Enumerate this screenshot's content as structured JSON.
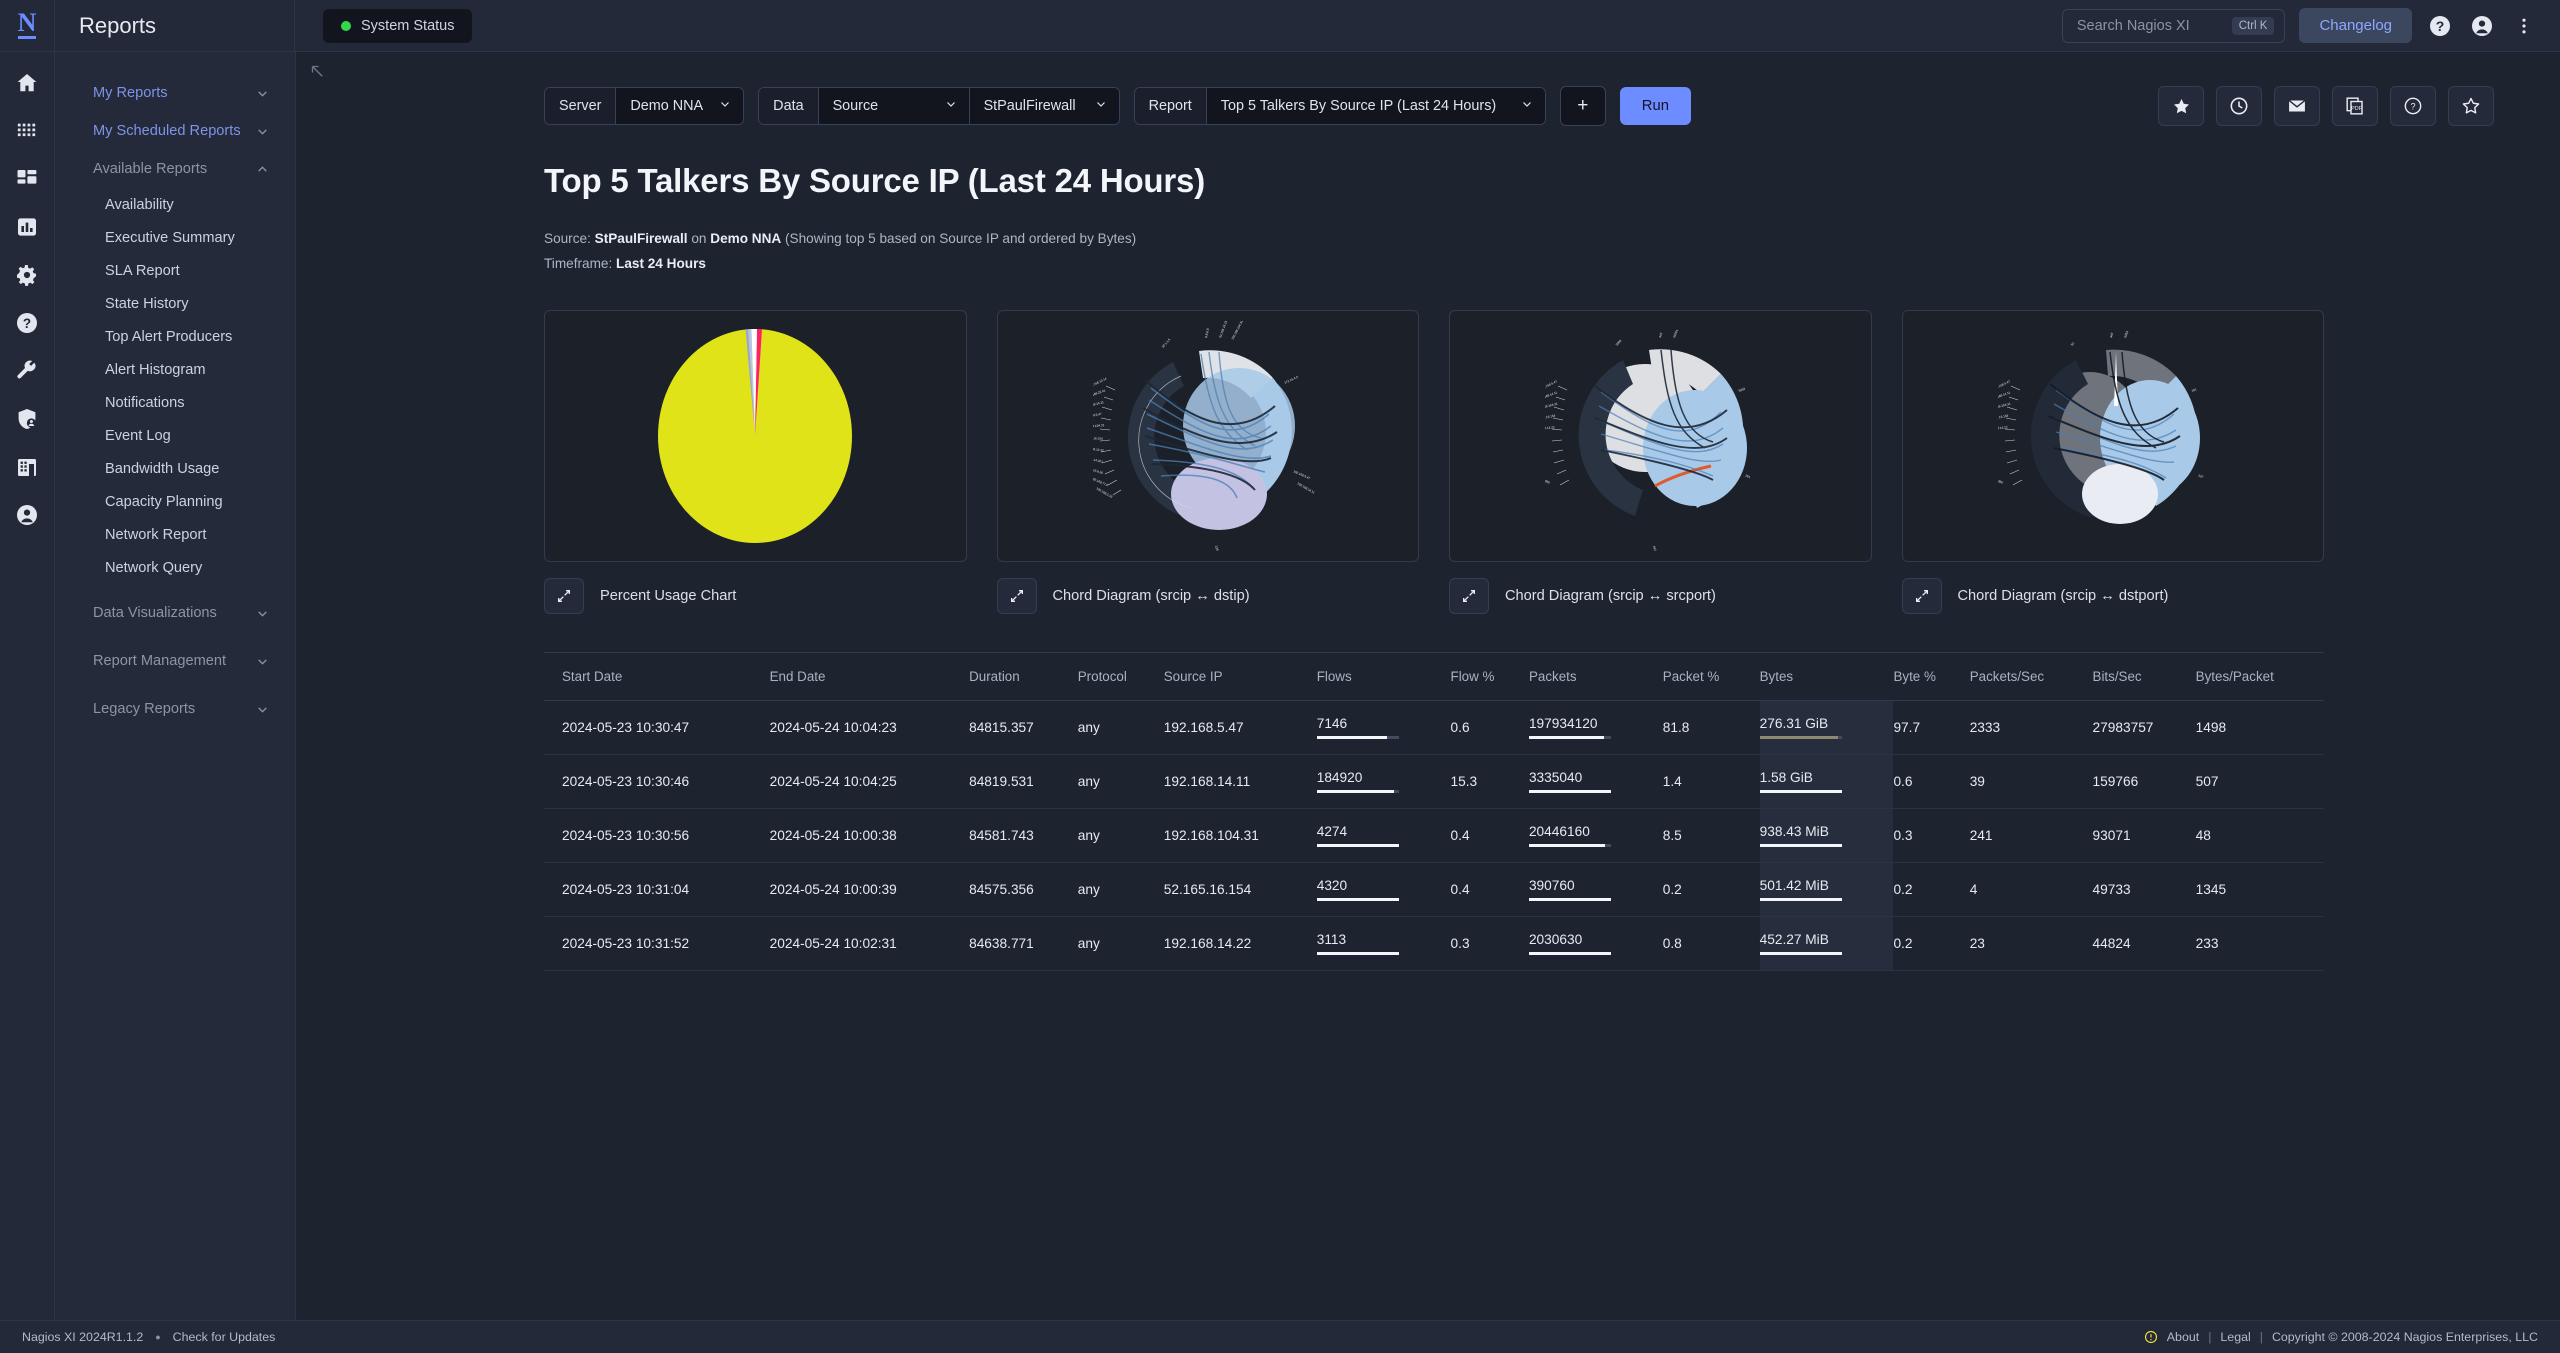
{
  "topbar": {
    "logo": "N",
    "app_title": "Reports",
    "system_status": "System Status",
    "search_placeholder": "Search Nagios XI",
    "search_shortcut": "Ctrl K",
    "changelog": "Changelog",
    "help_icon": "help-circle-icon",
    "account_icon": "account-circle-icon",
    "more_icon": "more-vertical-icon"
  },
  "rail": [
    {
      "name": "home-icon"
    },
    {
      "name": "apps-grid-icon"
    },
    {
      "name": "dashboard-icon"
    },
    {
      "name": "bar-chart-icon"
    },
    {
      "name": "gear-icon"
    },
    {
      "name": "help-circle-icon"
    },
    {
      "name": "wrench-icon"
    },
    {
      "name": "shield-user-icon"
    },
    {
      "name": "building-icon"
    },
    {
      "name": "user-circle-icon"
    }
  ],
  "sidebar": {
    "groups": [
      {
        "label": "My Reports",
        "expanded": false,
        "muted": false
      },
      {
        "label": "My Scheduled Reports",
        "expanded": false,
        "muted": false
      }
    ],
    "available_reports_label": "Available Reports",
    "items": [
      {
        "label": "Availability"
      },
      {
        "label": "Executive Summary"
      },
      {
        "label": "SLA Report"
      },
      {
        "label": "State History"
      },
      {
        "label": "Top Alert Producers"
      },
      {
        "label": "Alert Histogram"
      },
      {
        "label": "Notifications"
      },
      {
        "label": "Event Log"
      },
      {
        "label": "Bandwidth Usage"
      },
      {
        "label": "Capacity Planning"
      },
      {
        "label": "Network Report"
      },
      {
        "label": "Network Query"
      }
    ],
    "bottom_groups": [
      {
        "label": "Data Visualizations"
      },
      {
        "label": "Report Management"
      },
      {
        "label": "Legacy Reports"
      }
    ]
  },
  "toolbar": {
    "server_label": "Server",
    "server_value": "Demo NNA",
    "data_label": "Data",
    "data_value": "Source",
    "source_value": "StPaulFirewall",
    "report_label": "Report",
    "report_value": "Top 5 Talkers By Source IP (Last 24 Hours)",
    "add_label": "+",
    "run_label": "Run",
    "icons": [
      {
        "name": "star-filled-icon"
      },
      {
        "name": "clock-icon"
      },
      {
        "name": "envelope-icon"
      },
      {
        "name": "pdf-copy-icon"
      },
      {
        "name": "help-circle-icon"
      },
      {
        "name": "star-outline-icon"
      }
    ]
  },
  "report": {
    "title": "Top 5 Talkers By Source IP (Last 24 Hours)",
    "source_prefix": "Source:",
    "source_name": "StPaulFirewall",
    "source_on": "on",
    "source_server": "Demo NNA",
    "source_suffix": "(Showing top 5 based on Source IP and ordered by Bytes)",
    "timeframe_label": "Timeframe:",
    "timeframe_value": "Last 24 Hours"
  },
  "cards": [
    {
      "caption": "Percent Usage Chart",
      "type": "pie"
    },
    {
      "caption": "Chord Diagram (srcip ↔ dstip)",
      "type": "chord"
    },
    {
      "caption": "Chord Diagram (srcip ↔ srcport)",
      "type": "chord"
    },
    {
      "caption": "Chord Diagram (srcip ↔ dstport)",
      "type": "chord"
    }
  ],
  "table": {
    "columns": [
      "Start Date",
      "End Date",
      "Duration",
      "Protocol",
      "Source IP",
      "Flows",
      "Flow %",
      "Packets",
      "Packet %",
      "Bytes",
      "Byte %",
      "Packets/Sec",
      "Bits/Sec",
      "Bytes/Packet"
    ],
    "rows": [
      {
        "start_date": "2024-05-23 10:30:47",
        "end_date": "2024-05-24 10:04:23",
        "duration": "84815.357",
        "protocol": "any",
        "source_ip": "192.168.5.47",
        "flows": "7146",
        "flow_pct": "0.6",
        "flows_bar": 86,
        "packets": "197934120",
        "packet_pct": "81.8",
        "packets_bar": 92,
        "bytes": "276.31 GiB",
        "byte_pct": "97.7",
        "bytes_bar": 96,
        "packets_sec": "2333",
        "bits_sec": "27983757",
        "bytes_packet": "1498"
      },
      {
        "start_date": "2024-05-23 10:30:46",
        "end_date": "2024-05-24 10:04:25",
        "duration": "84819.531",
        "protocol": "any",
        "source_ip": "192.168.14.11",
        "flows": "184920",
        "flow_pct": "15.3",
        "flows_bar": 94,
        "packets": "3335040",
        "packet_pct": "1.4",
        "packets_bar": 100,
        "bytes": "1.58 GiB",
        "byte_pct": "0.6",
        "bytes_bar": 100,
        "packets_sec": "39",
        "bits_sec": "159766",
        "bytes_packet": "507"
      },
      {
        "start_date": "2024-05-23 10:30:56",
        "end_date": "2024-05-24 10:00:38",
        "duration": "84581.743",
        "protocol": "any",
        "source_ip": "192.168.104.31",
        "flows": "4274",
        "flow_pct": "0.4",
        "flows_bar": 100,
        "packets": "20446160",
        "packet_pct": "8.5",
        "packets_bar": 93,
        "bytes": "938.43 MiB",
        "byte_pct": "0.3",
        "bytes_bar": 100,
        "packets_sec": "241",
        "bits_sec": "93071",
        "bytes_packet": "48"
      },
      {
        "start_date": "2024-05-23 10:31:04",
        "end_date": "2024-05-24 10:00:39",
        "duration": "84575.356",
        "protocol": "any",
        "source_ip": "52.165.16.154",
        "flows": "4320",
        "flow_pct": "0.4",
        "flows_bar": 100,
        "packets": "390760",
        "packet_pct": "0.2",
        "packets_bar": 100,
        "bytes": "501.42 MiB",
        "byte_pct": "0.2",
        "bytes_bar": 100,
        "packets_sec": "4",
        "bits_sec": "49733",
        "bytes_packet": "1345"
      },
      {
        "start_date": "2024-05-23 10:31:52",
        "end_date": "2024-05-24 10:02:31",
        "duration": "84638.771",
        "protocol": "any",
        "source_ip": "192.168.14.22",
        "flows": "3113",
        "flow_pct": "0.3",
        "flows_bar": 100,
        "packets": "2030630",
        "packet_pct": "0.8",
        "packets_bar": 100,
        "bytes": "452.27 MiB",
        "byte_pct": "0.2",
        "bytes_bar": 100,
        "packets_sec": "23",
        "bits_sec": "44824",
        "bytes_packet": "233"
      }
    ]
  },
  "chart_data": {
    "type": "pie",
    "title": "Percent Usage Chart",
    "categories": [
      "192.168.5.47",
      "192.168.14.11",
      "192.168.104.31",
      "52.165.16.154",
      "192.168.14.22"
    ],
    "values": [
      97.7,
      0.6,
      0.3,
      0.2,
      0.2
    ],
    "unit": "%",
    "colors": [
      "#dfe317",
      "#ff1f6b",
      "#b8c4e8",
      "#9aa8cf",
      "#e8e8e8"
    ],
    "legend": "none",
    "xlabel": "",
    "ylabel": ""
  },
  "footer": {
    "version": "Nagios XI 2024R1.1.2",
    "check_updates": "Check for Updates",
    "about": "About",
    "legal": "Legal",
    "copyright": "Copyright © 2008-2024 Nagios Enterprises, LLC"
  }
}
